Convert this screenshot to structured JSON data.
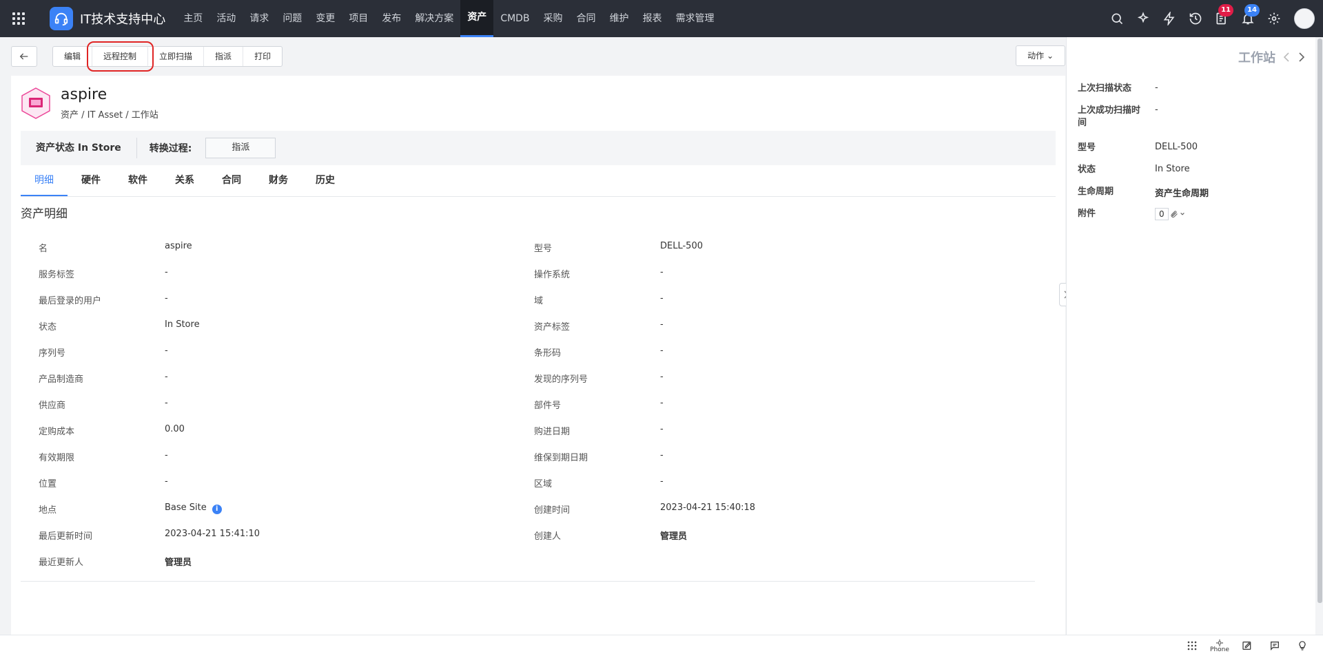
{
  "app": {
    "title": "IT技术支持中心"
  },
  "nav": [
    {
      "label": "主页"
    },
    {
      "label": "活动"
    },
    {
      "label": "请求"
    },
    {
      "label": "问题"
    },
    {
      "label": "变更"
    },
    {
      "label": "项目"
    },
    {
      "label": "发布"
    },
    {
      "label": "解决方案"
    },
    {
      "label": "资产"
    },
    {
      "label": "CMDB"
    },
    {
      "label": "采购"
    },
    {
      "label": "合同"
    },
    {
      "label": "维护"
    },
    {
      "label": "报表"
    },
    {
      "label": "需求管理"
    }
  ],
  "badges": {
    "tasks": "11",
    "notifications": "14"
  },
  "toolbar": {
    "edit": "编辑",
    "remote": "远程控制",
    "scan": "立即扫描",
    "assign": "指派",
    "print": "打印",
    "actions": "动作 ⌄"
  },
  "asset": {
    "name": "aspire",
    "breadcrumb": "资产 / IT Asset / 工作站",
    "status": "资产状态 In Store",
    "transition_label": "转换过程:",
    "transition_btn": "指派"
  },
  "tabs": [
    {
      "label": "明细"
    },
    {
      "label": "硬件"
    },
    {
      "label": "软件"
    },
    {
      "label": "关系"
    },
    {
      "label": "合同"
    },
    {
      "label": "财务"
    },
    {
      "label": "历史"
    }
  ],
  "section_title": "资产明细",
  "details": {
    "left": [
      {
        "label": "名",
        "value": "aspire"
      },
      {
        "label": "服务标签",
        "value": "-"
      },
      {
        "label": "最后登录的用户",
        "value": "-"
      },
      {
        "label": "状态",
        "value": "In Store"
      },
      {
        "label": "序列号",
        "value": "-"
      },
      {
        "label": "产品制造商",
        "value": "-"
      },
      {
        "label": "供应商",
        "value": "-"
      },
      {
        "label": "定购成本",
        "value": "0.00"
      },
      {
        "label": "有效期限",
        "value": "-"
      },
      {
        "label": "位置",
        "value": "-"
      },
      {
        "label": "地点",
        "value": "Base Site"
      },
      {
        "label": "最后更新时间",
        "value": "2023-04-21 15:41:10"
      },
      {
        "label": "最近更新人",
        "value": "管理员"
      }
    ],
    "right": [
      {
        "label": "型号",
        "value": "DELL-500"
      },
      {
        "label": "操作系统",
        "value": "-"
      },
      {
        "label": "域",
        "value": "-"
      },
      {
        "label": "资产标签",
        "value": "-"
      },
      {
        "label": "条形码",
        "value": "-"
      },
      {
        "label": "发现的序列号",
        "value": "-"
      },
      {
        "label": "部件号",
        "value": "-"
      },
      {
        "label": "购进日期",
        "value": "-"
      },
      {
        "label": "维保到期日期",
        "value": "-"
      },
      {
        "label": "区域",
        "value": "-"
      },
      {
        "label": "创建时间",
        "value": "2023-04-21 15:40:18"
      },
      {
        "label": "创建人",
        "value": "管理员"
      }
    ],
    "info_glyph": "i"
  },
  "right_panel": {
    "title": "工作站",
    "rows": [
      {
        "label": "上次扫描状态",
        "value": "-"
      },
      {
        "label": "上次成功扫描时间",
        "value": "-"
      },
      {
        "label": "型号",
        "value": "DELL-500"
      },
      {
        "label": "状态",
        "value": "In Store"
      },
      {
        "label": "生命周期",
        "value": "资产生命周期"
      },
      {
        "label": "附件",
        "value": "0"
      }
    ]
  },
  "bottombar": {
    "phone_label": "Phone"
  }
}
